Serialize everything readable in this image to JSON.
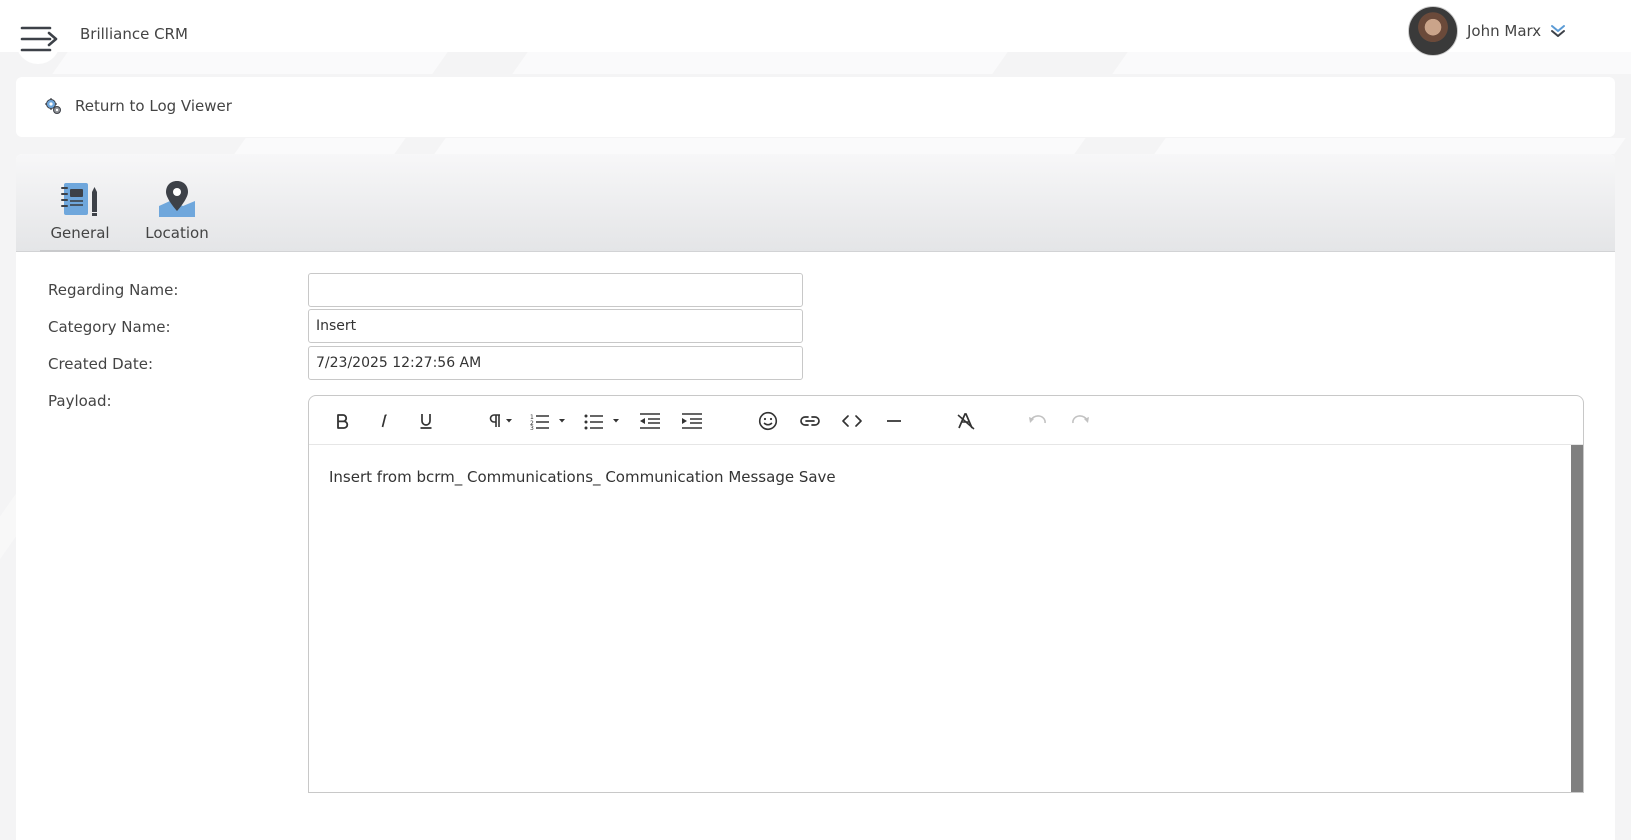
{
  "app": {
    "title": "Brilliance CRM"
  },
  "user": {
    "name": "John Marx"
  },
  "nav": {
    "return_label": "Return to Log Viewer"
  },
  "tabs": [
    {
      "label": "General",
      "icon": "notebook-icon"
    },
    {
      "label": "Location",
      "icon": "map-pin-icon"
    }
  ],
  "form": {
    "regarding_name": {
      "label": "Regarding Name:",
      "value": ""
    },
    "category_name": {
      "label": "Category Name:",
      "value": "Insert"
    },
    "created_date": {
      "label": "Created Date:",
      "value": "7/23/2025 12:27:56 AM"
    },
    "payload": {
      "label": "Payload:",
      "content": "Insert from bcrm_ Communications_ Communication Message Save"
    }
  },
  "editor_toolbar": [
    "bold-icon",
    "italic-icon",
    "underline-icon",
    "paragraph-icon",
    "ordered-list-icon",
    "unordered-list-icon",
    "outdent-icon",
    "indent-icon",
    "emoji-icon",
    "link-icon",
    "code-icon",
    "horizontal-rule-icon",
    "clear-format-icon",
    "undo-icon",
    "redo-icon"
  ],
  "colors": {
    "accent_blue": "#5b9bd5",
    "icon_dark": "#3d4148",
    "scrollbar": "#808080"
  }
}
